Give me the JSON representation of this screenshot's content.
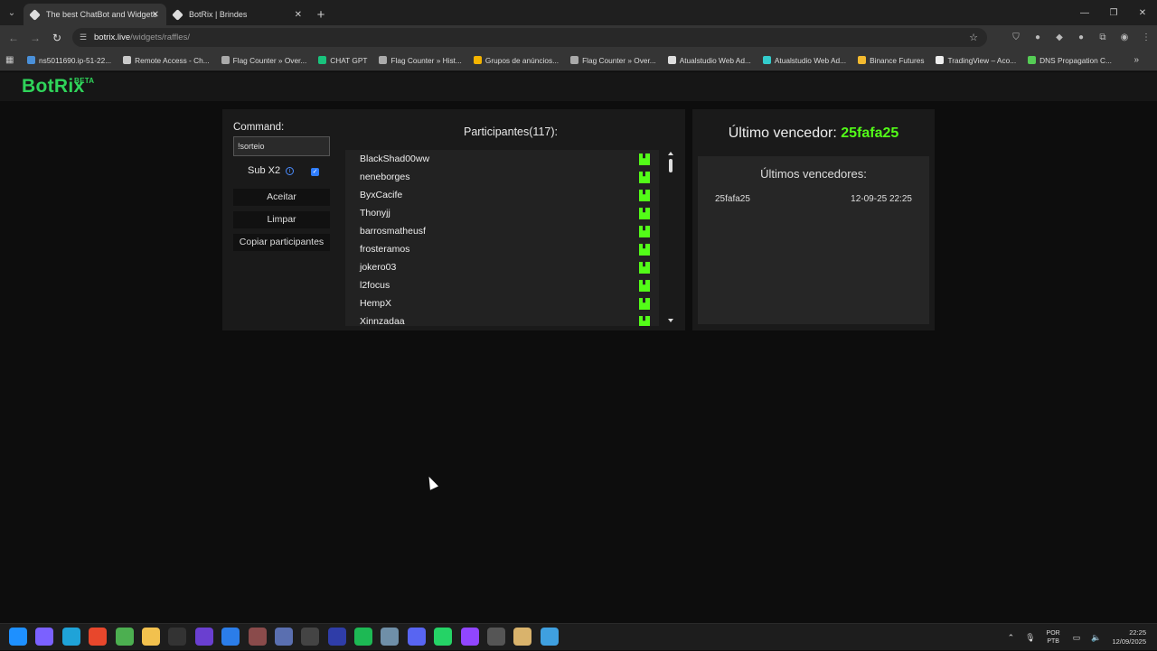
{
  "browser": {
    "tabs": [
      {
        "title": "The best ChatBot and Widgets",
        "active": true
      },
      {
        "title": "BotRix | Brindes",
        "active": false
      }
    ],
    "url_host": "botrix.live",
    "url_path": "/widgets/raffles/",
    "bookmarks": [
      "ns5011690.ip-51-22...",
      "Remote Access - Ch...",
      "Flag Counter » Over...",
      "CHAT GPT",
      "Flag Counter » Hist...",
      "Grupos de anúncios...",
      "Flag Counter » Over...",
      "Atualstudio Web Ad...",
      "Atualstudio Web Ad...",
      "Binance Futures",
      "TradingView – Aco...",
      "DNS Propagation C..."
    ]
  },
  "app": {
    "logo": "BotRix",
    "logo_badge": "BETA"
  },
  "raffle": {
    "command_label": "Command:",
    "command_value": "!sorteio",
    "sub_label": "Sub X2",
    "sub_checked": true,
    "buttons": {
      "accept": "Aceitar",
      "clear": "Limpar",
      "copy": "Copiar participantes"
    },
    "participants_title": "Participantes(117):",
    "participants": [
      "BlackShad00ww",
      "neneborges",
      "ByxCacife",
      "Thonyjj",
      "barrosmatheusf",
      "frosteramos",
      "jokero03",
      "l2focus",
      "HempX",
      "Xinnzadaa"
    ]
  },
  "winners": {
    "last_winner_label": "Último vencedor:",
    "last_winner_name": "25fafa25",
    "history_title": "Últimos vencedores:",
    "history": [
      {
        "name": "25fafa25",
        "time": "12-09-25 22:25"
      }
    ]
  },
  "taskbar": {
    "lang_line1": "POR",
    "lang_line2": "PTB",
    "time": "22:25",
    "date": "12/09/2025"
  },
  "colors": {
    "accent_green": "#53fc18",
    "logo_green": "#2fd45a",
    "check_blue": "#2f7dff"
  }
}
